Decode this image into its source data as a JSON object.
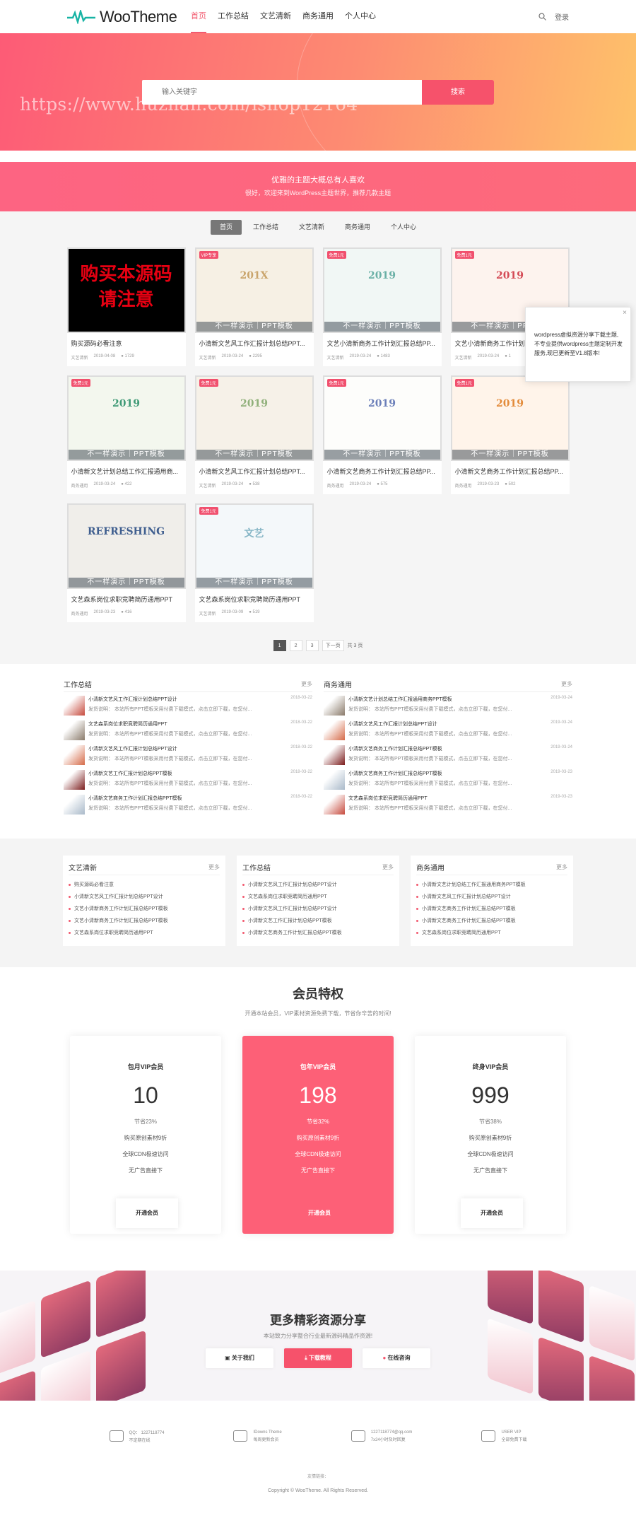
{
  "header": {
    "logo": "WooTheme",
    "nav": [
      "首页",
      "工作总结",
      "文艺清新",
      "商务通用",
      "个人中心"
    ],
    "login": "登录"
  },
  "hero": {
    "search_placeholder": "输入关键字",
    "search_button": "搜索",
    "watermark": "https://www.huzhan.com/ishop12164"
  },
  "banner": {
    "line1": "优雅的主题大概总有人喜欢",
    "line2": "很好，欢迎来到WordPress主题世界，推荐几款主题"
  },
  "tabs": [
    "首页",
    "工作总结",
    "文艺清新",
    "商务通用",
    "个人中心"
  ],
  "cards": [
    {
      "title": "购买源码必看注意",
      "cat": "文艺清新",
      "date": "2019-04-08",
      "views": "1729",
      "vip": "",
      "thumb": "购买本源码请注意"
    },
    {
      "title": "小清新文艺风工作汇报计划总结PPT...",
      "cat": "文艺清新",
      "date": "2019-03-24",
      "views": "2295",
      "vip": "VIP专享",
      "thumb": "201X"
    },
    {
      "title": "文艺小清新商务工作计划汇报总结PP...",
      "cat": "文艺清新",
      "date": "2019-03-24",
      "views": "1483",
      "vip": "免费1元",
      "thumb": "2019"
    },
    {
      "title": "文艺小清新商务工作计划汇报总结PP...",
      "cat": "文艺清新",
      "date": "2019-03-24",
      "views": "1",
      "vip": "免费1元",
      "thumb": "2019"
    },
    {
      "title": "小清新文艺计划总结工作汇报通用商...",
      "cat": "商务通用",
      "date": "2019-03-24",
      "views": "422",
      "vip": "免费1元",
      "thumb": "2019"
    },
    {
      "title": "小清新文艺风工作汇报计划总结PPT...",
      "cat": "文艺清新",
      "date": "2019-03-24",
      "views": "538",
      "vip": "免费1元",
      "thumb": "2019"
    },
    {
      "title": "小清新文艺商务工作计划汇报总结PP...",
      "cat": "商务通用",
      "date": "2019-03-24",
      "views": "575",
      "vip": "免费1元",
      "thumb": "2019"
    },
    {
      "title": "小清新文艺商务工作计划汇报总结PP...",
      "cat": "商务通用",
      "date": "2019-03-23",
      "views": "502",
      "vip": "免费1元",
      "thumb": "2019"
    },
    {
      "title": "文艺森系岗位求职竞聘简历通用PPT",
      "cat": "商务通用",
      "date": "2019-03-23",
      "views": "416",
      "vip": "",
      "thumb": "REFRESHING"
    },
    {
      "title": "文艺森系岗位求职竞聘简历通用PPT",
      "cat": "文艺清新",
      "date": "2019-03-09",
      "views": "519",
      "vip": "免费1元",
      "thumb": "文艺"
    }
  ],
  "card_watermark": "不一样演示｜PPT模板",
  "pager": {
    "pages": [
      "1",
      "2",
      "3"
    ],
    "next": "下一页",
    "total": "共 3 页"
  },
  "lists": [
    {
      "title": "工作总结",
      "more": "更多",
      "items": [
        {
          "t": "小清新文艺风工作汇报计划总结PPT设计",
          "d": "2018-03-22",
          "desc": "发货说明：  本站所有PPT模板采用付费下载模式，点击立即下载，在您付..."
        },
        {
          "t": "文艺森系岗位求职竞聘简历通用PPT",
          "d": "2018-03-22",
          "desc": "发货说明：  本站所有PPT模板采用付费下载模式，点击立即下载，在您付..."
        },
        {
          "t": "小清新文艺风工作汇报计划总结PPT设计",
          "d": "2018-03-22",
          "desc": "发货说明：  本站所有PPT模板采用付费下载模式，点击立即下载，在您付..."
        },
        {
          "t": "小清新文艺工作汇报计划总结PPT模板",
          "d": "2018-03-22",
          "desc": "发货说明：  本站所有PPT模板采用付费下载模式，点击立即下载，在您付..."
        },
        {
          "t": "小清新文艺商务工作计划汇报总结PPT模板",
          "d": "2018-03-22",
          "desc": "发货说明：  本站所有PPT模板采用付费下载模式，点击立即下载，在您付..."
        }
      ]
    },
    {
      "title": "商务通用",
      "more": "更多",
      "items": [
        {
          "t": "小清新文艺计划总结工作汇报通用商务PPT模板",
          "d": "2019-03-24",
          "desc": "发货说明：  本站所有PPT模板采用付费下载模式，点击立即下载，在您付..."
        },
        {
          "t": "小清新文艺风工作汇报计划总结PPT设计",
          "d": "2019-03-24",
          "desc": "发货说明：  本站所有PPT模板采用付费下载模式，点击立即下载，在您付..."
        },
        {
          "t": "小清新文艺商务工作计划汇报总结PPT模板",
          "d": "2019-03-24",
          "desc": "发货说明：  本站所有PPT模板采用付费下载模式，点击立即下载，在您付..."
        },
        {
          "t": "小清新文艺商务工作计划汇报总结PPT模板",
          "d": "2019-03-23",
          "desc": "发货说明：  本站所有PPT模板采用付费下载模式，点击立即下载，在您付..."
        },
        {
          "t": "文艺森系岗位求职竞聘简历通用PPT",
          "d": "2019-03-23",
          "desc": "发货说明：  本站所有PPT模板采用付费下载模式，点击立即下载，在您付..."
        }
      ]
    }
  ],
  "tri": [
    {
      "title": "文艺清新",
      "more": "更多",
      "items": [
        "购买源码必看注意",
        "小清新文艺风工作汇报计划总结PPT设计",
        "文艺小清新商务工作计划汇报总结PPT模板",
        "文艺小清新商务工作计划汇报总结PPT模板",
        "文艺森系岗位求职竞聘简历通用PPT"
      ]
    },
    {
      "title": "工作总结",
      "more": "更多",
      "items": [
        "小清新文艺风工作汇报计划总结PPT设计",
        "文艺森系岗位求职竞聘简历通用PPT",
        "小清新文艺风工作汇报计划总结PPT设计",
        "小清新文艺工作汇报计划总结PPT模板",
        "小清新文艺商务工作计划汇报总结PPT模板"
      ]
    },
    {
      "title": "商务通用",
      "more": "更多",
      "items": [
        "小清新文艺计划总结工作汇报通用商务PPT模板",
        "小清新文艺风工作汇报计划总结PPT设计",
        "小清新文艺商务工作计划汇报总结PPT模板",
        "小清新文艺商务工作计划汇报总结PPT模板",
        "文艺森系岗位求职竞聘简历通用PPT"
      ]
    }
  ],
  "vip": {
    "title": "会员特权",
    "subtitle": "开通本站会员，VIP素材资源免费下载，节省你辛苦的时间!",
    "plans": [
      {
        "name": "包月VIP会员",
        "price": "10",
        "f": [
          "节省23%",
          "购买原创素材9折",
          "全球CDN极速访问",
          "无广告直接下"
        ],
        "btn": "开通会员"
      },
      {
        "name": "包年VIP会员",
        "price": "198",
        "f": [
          "节省32%",
          "购买原创素材9折",
          "全球CDN极速访问",
          "无广告直接下"
        ],
        "btn": "开通会员"
      },
      {
        "name": "终身VIP会员",
        "price": "999",
        "f": [
          "节省38%",
          "购买原创素材9折",
          "全球CDN极速访问",
          "无广告直接下"
        ],
        "btn": "开通会员"
      }
    ]
  },
  "promo": {
    "title": "更多精彩资源分享",
    "subtitle": "本站致力分享整合行业最新源码精品作资源!",
    "buttons": [
      "关于我们",
      "下载教程",
      "在线咨询"
    ]
  },
  "footer": {
    "items": [
      {
        "a": "QQ： 1227118774",
        "b": "不定期在线"
      },
      {
        "a": "IDowns Theme",
        "b": "每周更新会员"
      },
      {
        "a": "1227118774@qq.com",
        "b": "7x24小时及时回复"
      },
      {
        "a": "USER VIP",
        "b": "全部免费下载"
      }
    ],
    "links": "友情链接：",
    "copyright": "Copyright © WooTheme. All Rights Reserved."
  },
  "popup": {
    "text": "wordpress虚拟资源分享下载主题,不专业提供wordpress主题定制开发服务,现已更新至V1.8版本!",
    "close": "×"
  }
}
